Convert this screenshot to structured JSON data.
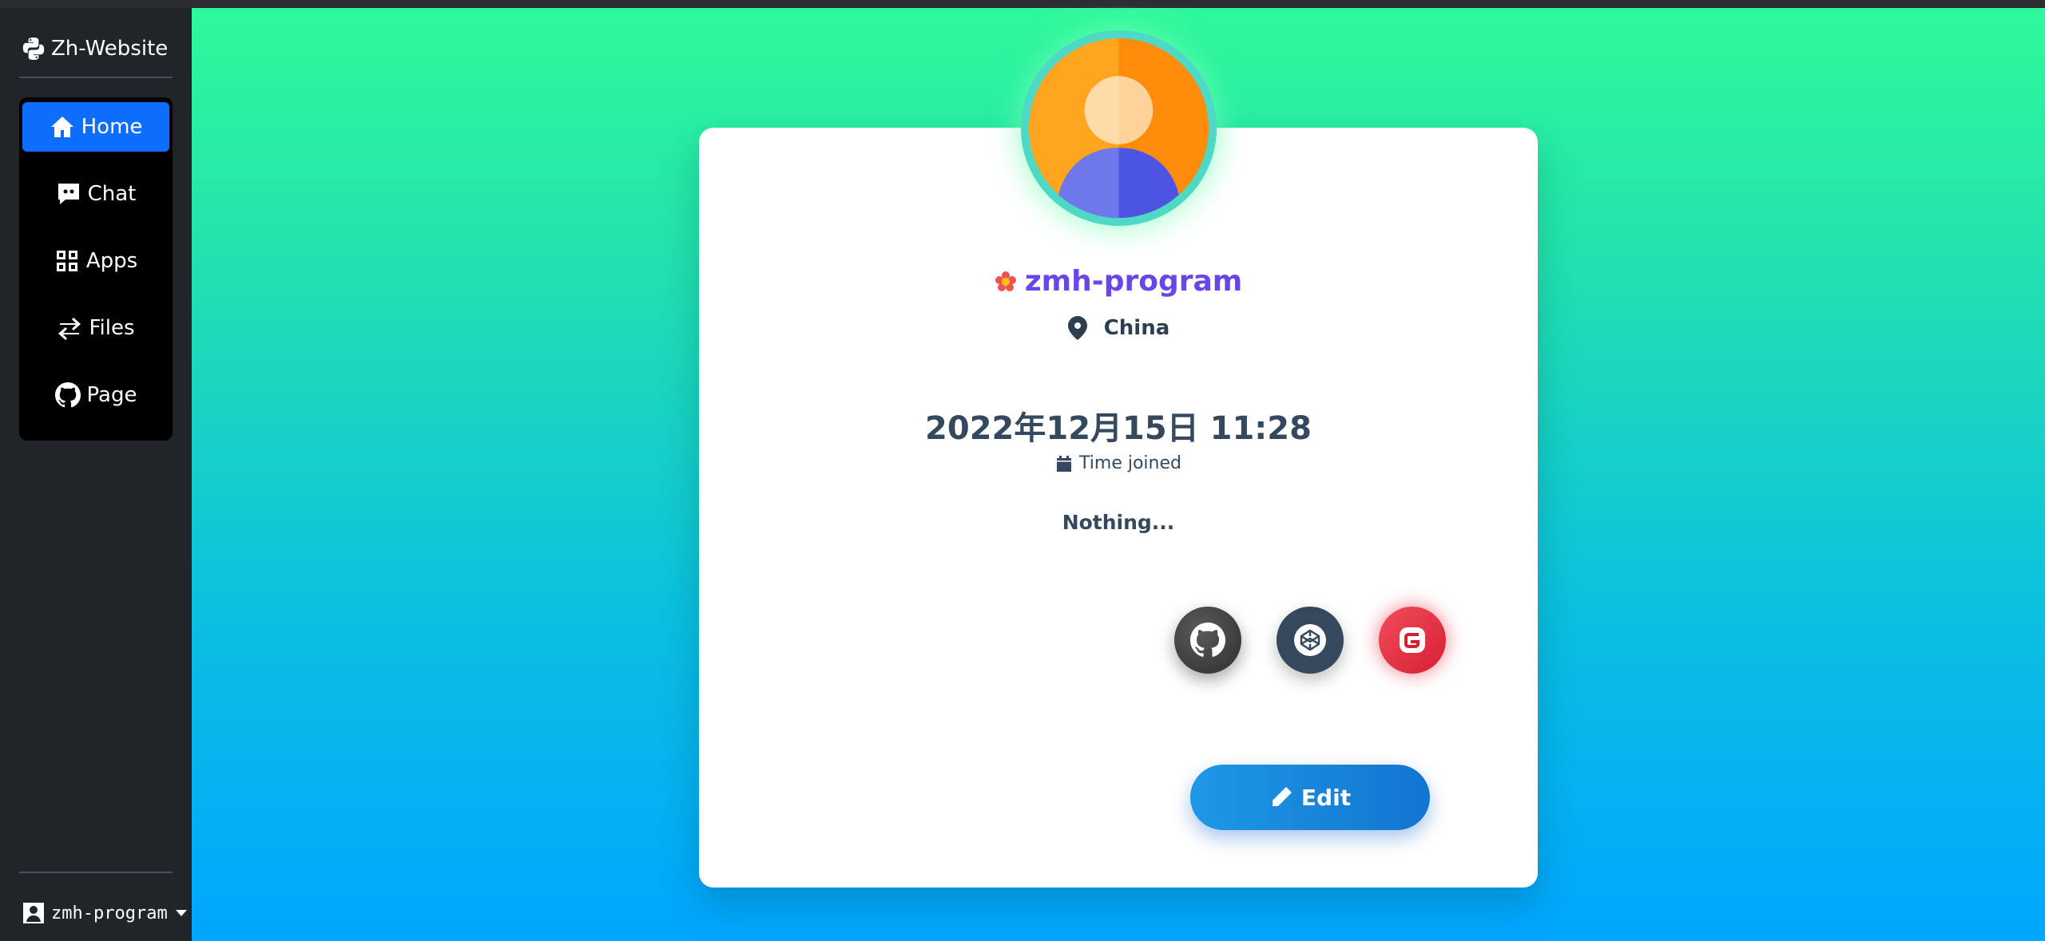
{
  "app": {
    "brand": "Zh-Website"
  },
  "sidebar": {
    "items": [
      {
        "label": "Home",
        "icon": "home-icon",
        "active": true
      },
      {
        "label": "Chat",
        "icon": "chat-icon",
        "active": false
      },
      {
        "label": "Apps",
        "icon": "grid-icon",
        "active": false
      },
      {
        "label": "Files",
        "icon": "transfer-icon",
        "active": false
      },
      {
        "label": "Page",
        "icon": "github-icon",
        "active": false
      }
    ],
    "user": "zmh-program"
  },
  "profile": {
    "username": "zmh-program",
    "location": "China",
    "joined_date": "2022年12月15日 11:28",
    "joined_label": "Time joined",
    "bio": "Nothing...",
    "social": [
      {
        "name": "github",
        "icon": "github-icon"
      },
      {
        "name": "codepen",
        "icon": "codepen-icon"
      },
      {
        "name": "gitee",
        "icon": "gitee-icon"
      }
    ],
    "edit_label": "Edit"
  },
  "colors": {
    "accent": "#0d6efd",
    "username": "#6a45e8",
    "gradient_top": "#2ef99a",
    "gradient_bottom": "#00a6ff"
  }
}
